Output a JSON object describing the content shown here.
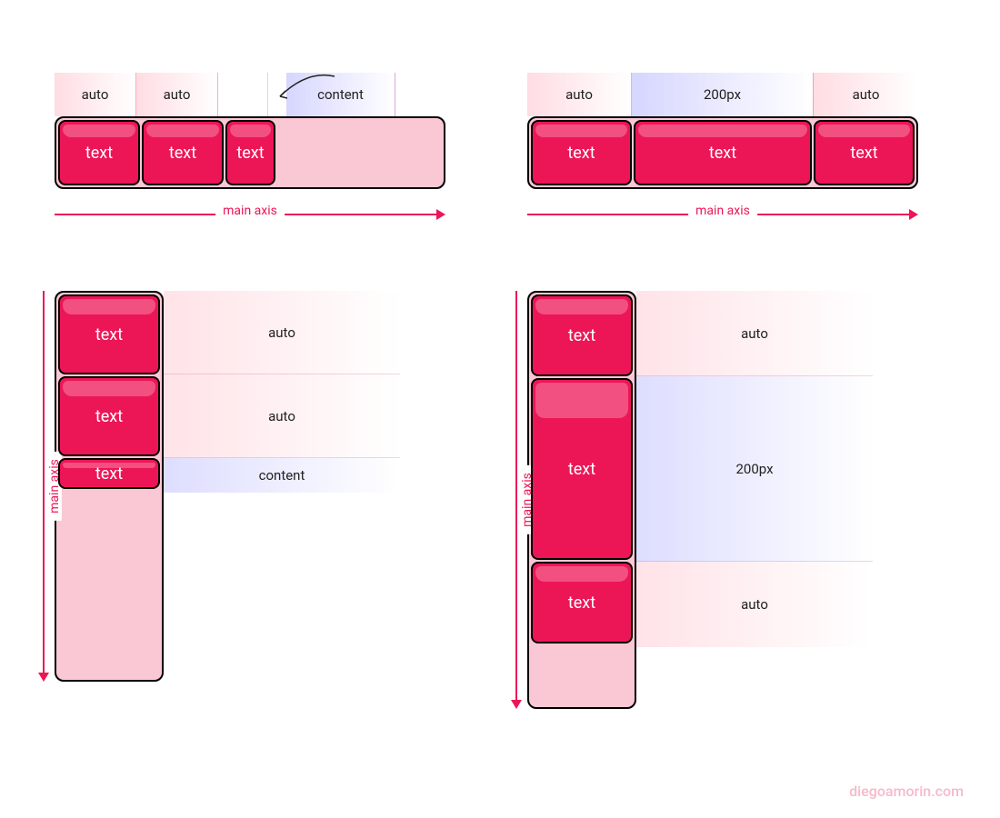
{
  "axis_label": "main axis",
  "item_text": "text",
  "diagrams": {
    "topLeft": {
      "direction": "row",
      "labels": [
        "auto",
        "auto",
        "content"
      ],
      "sizes": [
        "auto",
        "auto",
        "content"
      ],
      "callout_target_index": 2
    },
    "topRight": {
      "direction": "row",
      "labels": [
        "auto",
        "200px",
        "auto"
      ],
      "sizes": [
        "auto",
        "200px",
        "auto"
      ]
    },
    "bottomLeft": {
      "direction": "column",
      "labels": [
        "auto",
        "auto",
        "content"
      ],
      "sizes": [
        "auto",
        "auto",
        "content"
      ]
    },
    "bottomRight": {
      "direction": "column",
      "labels": [
        "auto",
        "200px",
        "auto"
      ],
      "sizes": [
        "auto",
        "200px",
        "auto"
      ]
    }
  },
  "credit": "diegoamorin.com"
}
